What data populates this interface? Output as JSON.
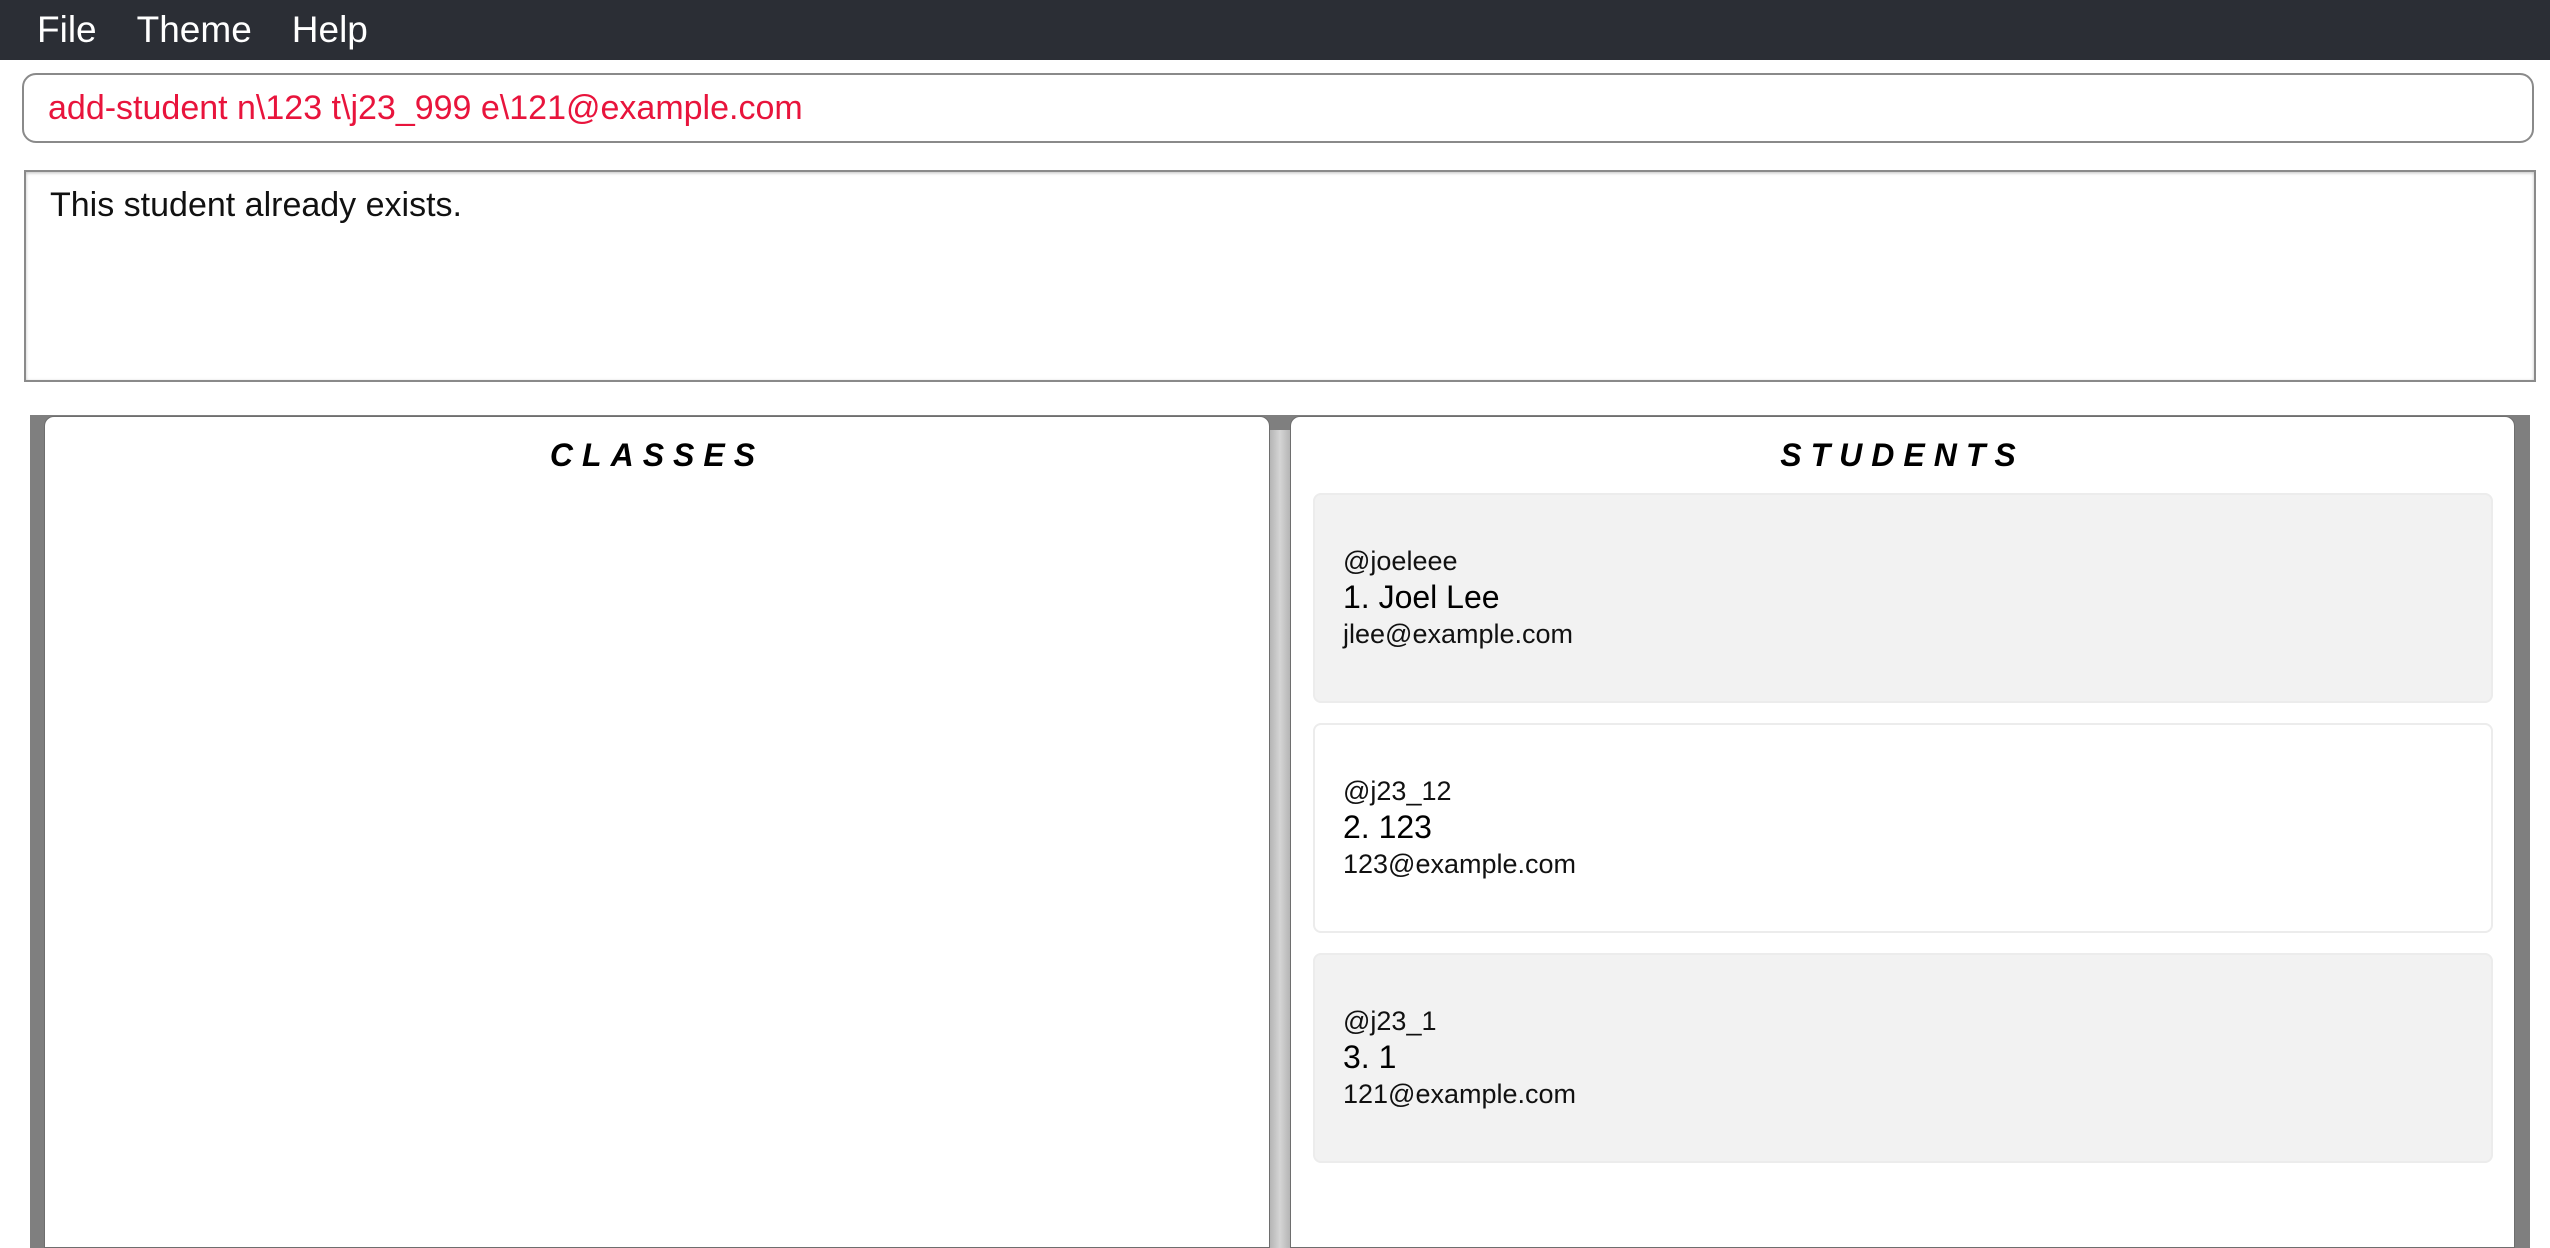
{
  "menu": {
    "items": [
      "File",
      "Theme",
      "Help"
    ]
  },
  "command": {
    "value": "add-student n\\123 t\\j23_999 e\\121@example.com"
  },
  "result": {
    "message": "This student already exists."
  },
  "classes_panel": {
    "title": "CLASSES"
  },
  "students_panel": {
    "title": "STUDENTS",
    "students": [
      {
        "handle": "@joeleee",
        "name": "1.  Joel Lee",
        "email": "jlee@example.com"
      },
      {
        "handle": "@j23_12",
        "name": "2.  123",
        "email": "123@example.com"
      },
      {
        "handle": "@j23_1",
        "name": "3.  1",
        "email": "121@example.com"
      }
    ]
  },
  "colors": {
    "menubar_bg": "#2b2e35",
    "command_text": "#e8143c",
    "card_shaded": "#f2f2f2"
  }
}
